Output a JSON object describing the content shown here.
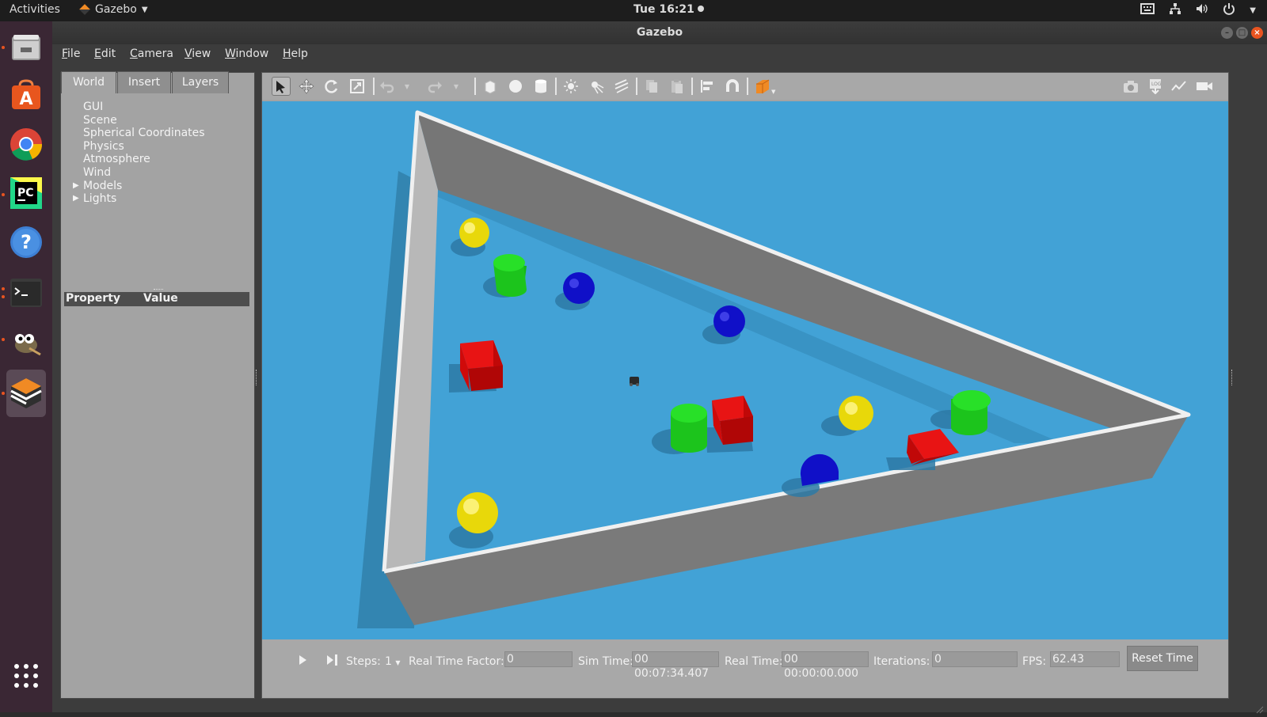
{
  "topbar": {
    "activities": "Activities",
    "app_name": "Gazebo",
    "clock": "Tue 16:21"
  },
  "window": {
    "title": "Gazebo"
  },
  "menu": [
    "File",
    "Edit",
    "Camera",
    "View",
    "Window",
    "Help"
  ],
  "left_panel": {
    "tabs": [
      "World",
      "Insert",
      "Layers"
    ],
    "tree": [
      "GUI",
      "Scene",
      "Spherical Coordinates",
      "Physics",
      "Atmosphere",
      "Wind",
      "Models",
      "Lights"
    ],
    "prop_col_property": "Property",
    "prop_col_value": "Value"
  },
  "bottom_bar": {
    "steps_label": "Steps:",
    "steps_value": "1",
    "rtf_label": "Real Time Factor:",
    "rtf_value": "0",
    "sim_time_label": "Sim Time:",
    "sim_time_value": "00 00:07:34.407",
    "real_time_label": "Real Time:",
    "real_time_value": "00 00:00:00.000",
    "iterations_label": "Iterations:",
    "iterations_value": "0",
    "fps_label": "FPS:",
    "fps_value": "62.43",
    "reset_label": "Reset Time"
  },
  "colors": {
    "sky": "#42a2d6",
    "wall_side": "#7c7c7c",
    "wall_top": "#f0f0f0",
    "red": "#e01818",
    "green": "#21d021",
    "blue": "#1414d0",
    "yellow": "#f0e010",
    "accent": "#e95420"
  },
  "icons": {
    "dock": [
      "files-icon",
      "software-icon",
      "chrome-icon",
      "pycharm-icon",
      "help-icon",
      "terminal-icon",
      "gimp-icon",
      "gazebo-icon",
      "app-grid-icon"
    ]
  }
}
